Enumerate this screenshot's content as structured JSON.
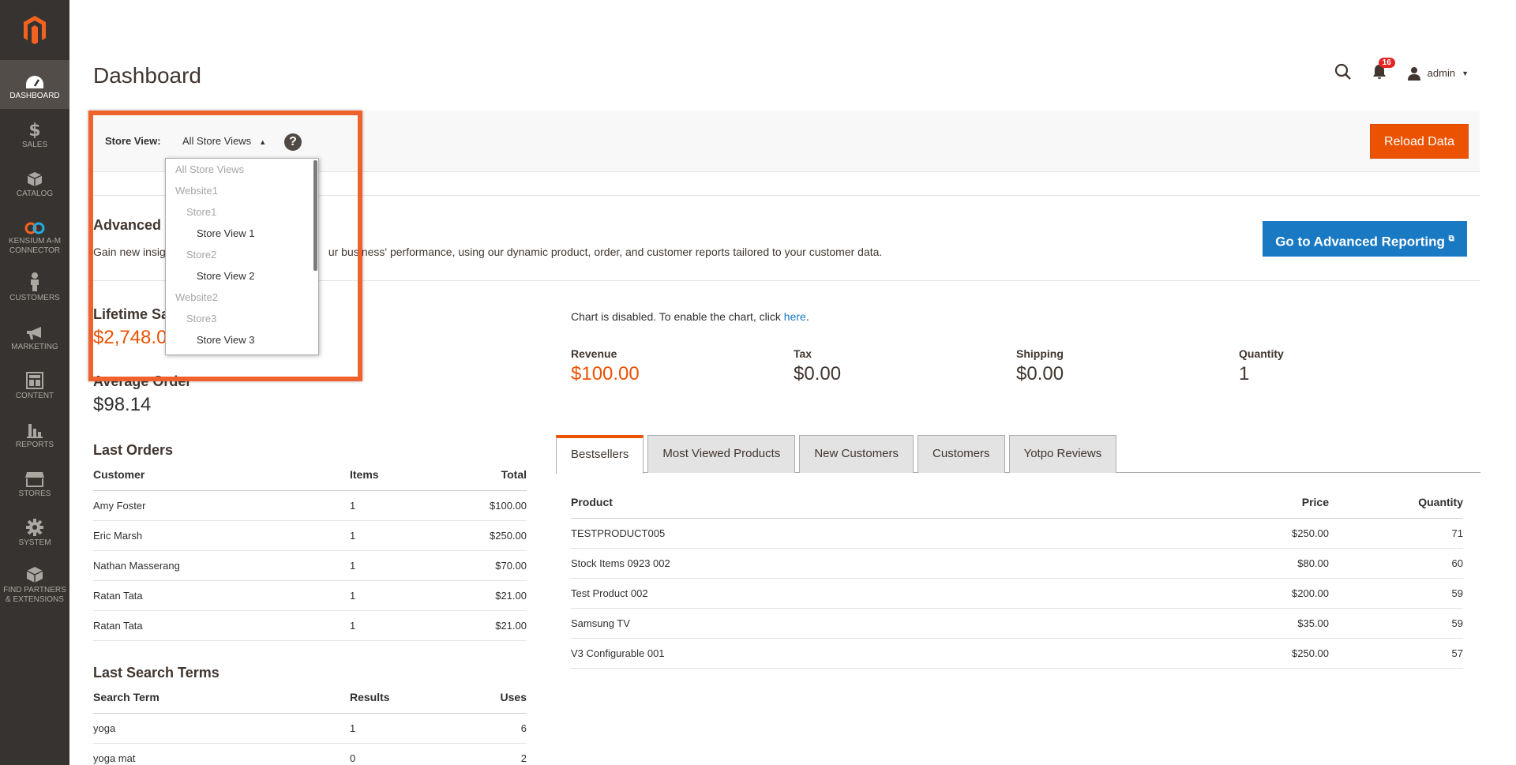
{
  "sidebar": {
    "logo": "magento-logo",
    "items": [
      {
        "label": "DASHBOARD",
        "icon": "dashboard-icon",
        "active": true
      },
      {
        "label": "SALES",
        "icon": "dollar-icon"
      },
      {
        "label": "CATALOG",
        "icon": "box-icon"
      },
      {
        "label": "KENSIUM A-M CONNECTOR",
        "icon": "connector-icon"
      },
      {
        "label": "CUSTOMERS",
        "icon": "person-icon"
      },
      {
        "label": "MARKETING",
        "icon": "megaphone-icon"
      },
      {
        "label": "CONTENT",
        "icon": "layout-icon"
      },
      {
        "label": "REPORTS",
        "icon": "bar-chart-icon"
      },
      {
        "label": "STORES",
        "icon": "store-icon"
      },
      {
        "label": "SYSTEM",
        "icon": "gear-icon"
      },
      {
        "label": "FIND PARTNERS & EXTENSIONS",
        "icon": "extensions-icon"
      }
    ]
  },
  "header": {
    "title": "Dashboard",
    "notifications_count": "16",
    "user": "admin"
  },
  "store_bar": {
    "label": "Store View:",
    "selected": "All Store Views",
    "reload_label": "Reload Data"
  },
  "store_dropdown": {
    "options": [
      {
        "label": "All Store Views",
        "level": 0,
        "dim": true
      },
      {
        "label": "Website1",
        "level": 0,
        "dim": true
      },
      {
        "label": "Store1",
        "level": 1,
        "dim": true
      },
      {
        "label": "Store View 1",
        "level": 3,
        "dim": false
      },
      {
        "label": "Store2",
        "level": 1,
        "dim": true
      },
      {
        "label": "Store View 2",
        "level": 3,
        "dim": false
      },
      {
        "label": "Website2",
        "level": 0,
        "dim": true
      },
      {
        "label": "Store3",
        "level": 1,
        "dim": true
      },
      {
        "label": "Store View 3",
        "level": 3,
        "dim": false
      }
    ]
  },
  "advanced": {
    "title": "Advanced",
    "desc_prefix": "Gain new insig",
    "desc_suffix": "ur business' performance, using our dynamic product, order, and customer reports tailored to your customer data.",
    "button": "Go to Advanced Reporting"
  },
  "stats": {
    "lifetime_label": "Lifetime Sa",
    "lifetime_value": "$2,748.0",
    "avg_label": "Average Order",
    "avg_value": "$98.14"
  },
  "last_orders": {
    "title": "Last Orders",
    "headers": [
      "Customer",
      "Items",
      "Total"
    ],
    "rows": [
      [
        "Amy Foster",
        "1",
        "$100.00"
      ],
      [
        "Eric Marsh",
        "1",
        "$250.00"
      ],
      [
        "Nathan Masserang",
        "1",
        "$70.00"
      ],
      [
        "Ratan Tata",
        "1",
        "$21.00"
      ],
      [
        "Ratan Tata",
        "1",
        "$21.00"
      ]
    ]
  },
  "last_search": {
    "title": "Last Search Terms",
    "headers": [
      "Search Term",
      "Results",
      "Uses"
    ],
    "rows": [
      [
        "yoga",
        "1",
        "6"
      ],
      [
        "yoga mat",
        "0",
        "2"
      ]
    ]
  },
  "chart": {
    "msg": "Chart is disabled. To enable the chart, click ",
    "link": "here",
    "after": "."
  },
  "totals": [
    {
      "label": "Revenue",
      "value": "$100.00"
    },
    {
      "label": "Tax",
      "value": "$0.00"
    },
    {
      "label": "Shipping",
      "value": "$0.00"
    },
    {
      "label": "Quantity",
      "value": "1"
    }
  ],
  "tabs": [
    "Bestsellers",
    "Most Viewed Products",
    "New Customers",
    "Customers",
    "Yotpo Reviews"
  ],
  "bestsellers": {
    "headers": [
      "Product",
      "Price",
      "Quantity"
    ],
    "rows": [
      [
        "TESTPRODUCT005",
        "$250.00",
        "71"
      ],
      [
        "Stock Items 0923 002",
        "$80.00",
        "60"
      ],
      [
        "Test Product 002",
        "$200.00",
        "59"
      ],
      [
        "Samsung TV",
        "$35.00",
        "59"
      ],
      [
        "V3 Configurable 001",
        "$250.00",
        "57"
      ]
    ]
  },
  "colors": {
    "accent": "#eb5202",
    "blue": "#1979c3",
    "sidebar": "#373330",
    "highlight": "#f0622b"
  }
}
